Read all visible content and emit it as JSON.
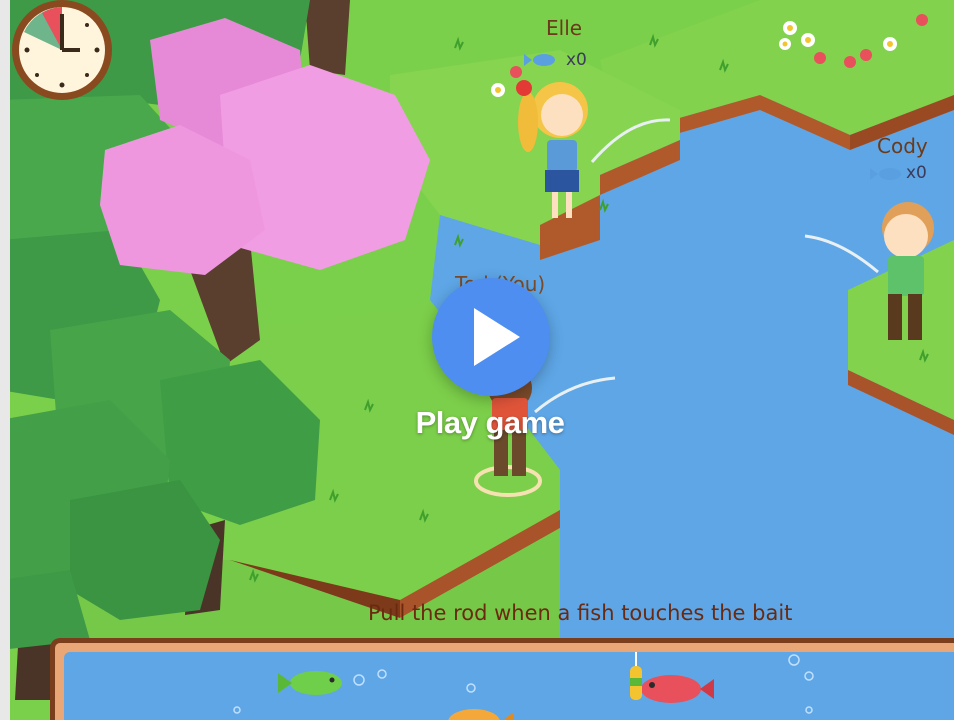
{
  "game": {
    "players": [
      {
        "name": "Elle",
        "fish_count": "x0"
      },
      {
        "name": "Cody",
        "fish_count": "x0"
      },
      {
        "name": "Tod (You)",
        "fish_count": ""
      }
    ],
    "overlay": {
      "play_label": "Play game"
    },
    "instruction": "Pull the rod when a fish touches the bait",
    "timer": {
      "elapsed_fraction": 0.2
    },
    "colors": {
      "water": "#5ea6e6",
      "grass": "#7ad04a",
      "dirt": "#a8532a",
      "play_button": "#4d8ef0",
      "label_text": "#6b3a1a"
    }
  }
}
